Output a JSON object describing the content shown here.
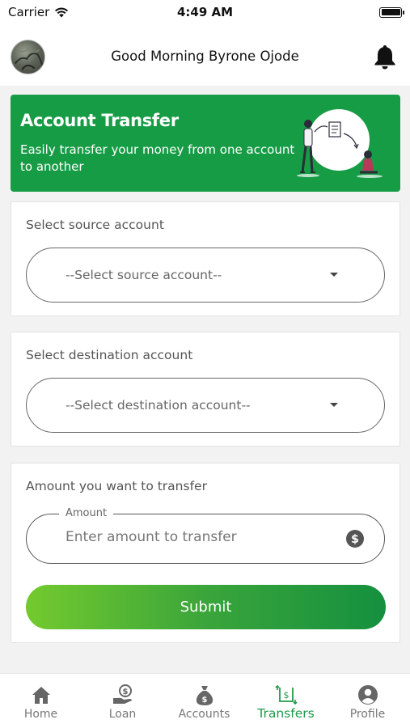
{
  "status_bar": {
    "carrier": "Carrier",
    "time": "4:49 AM"
  },
  "header": {
    "greeting": "Good Morning Byrone Ojode",
    "avatar_icon": "avatar",
    "notification_icon": "bell-icon"
  },
  "banner": {
    "title": "Account Transfer",
    "subtitle": "Easily transfer your money from one account to another",
    "color": "#179c46"
  },
  "source": {
    "label": "Select source account",
    "selected": "--Select source account--"
  },
  "destination": {
    "label": "Select destination account",
    "selected": "--Select destination account--"
  },
  "amount": {
    "label": "Amount you want to transfer",
    "field_label": "Amount",
    "placeholder": "Enter amount to transfer",
    "value": ""
  },
  "submit": {
    "label": "Submit"
  },
  "tabs": [
    {
      "label": "Home",
      "icon": "home-icon",
      "active": false
    },
    {
      "label": "Loan",
      "icon": "loan-icon",
      "active": false
    },
    {
      "label": "Accounts",
      "icon": "money-bag-icon",
      "active": false
    },
    {
      "label": "Transfers",
      "icon": "transfer-icon",
      "active": true
    },
    {
      "label": "Profile",
      "icon": "profile-icon",
      "active": false
    }
  ],
  "colors": {
    "accent": "#179c46",
    "tab_active": "#1e9a49",
    "tab_inactive": "#777777"
  }
}
